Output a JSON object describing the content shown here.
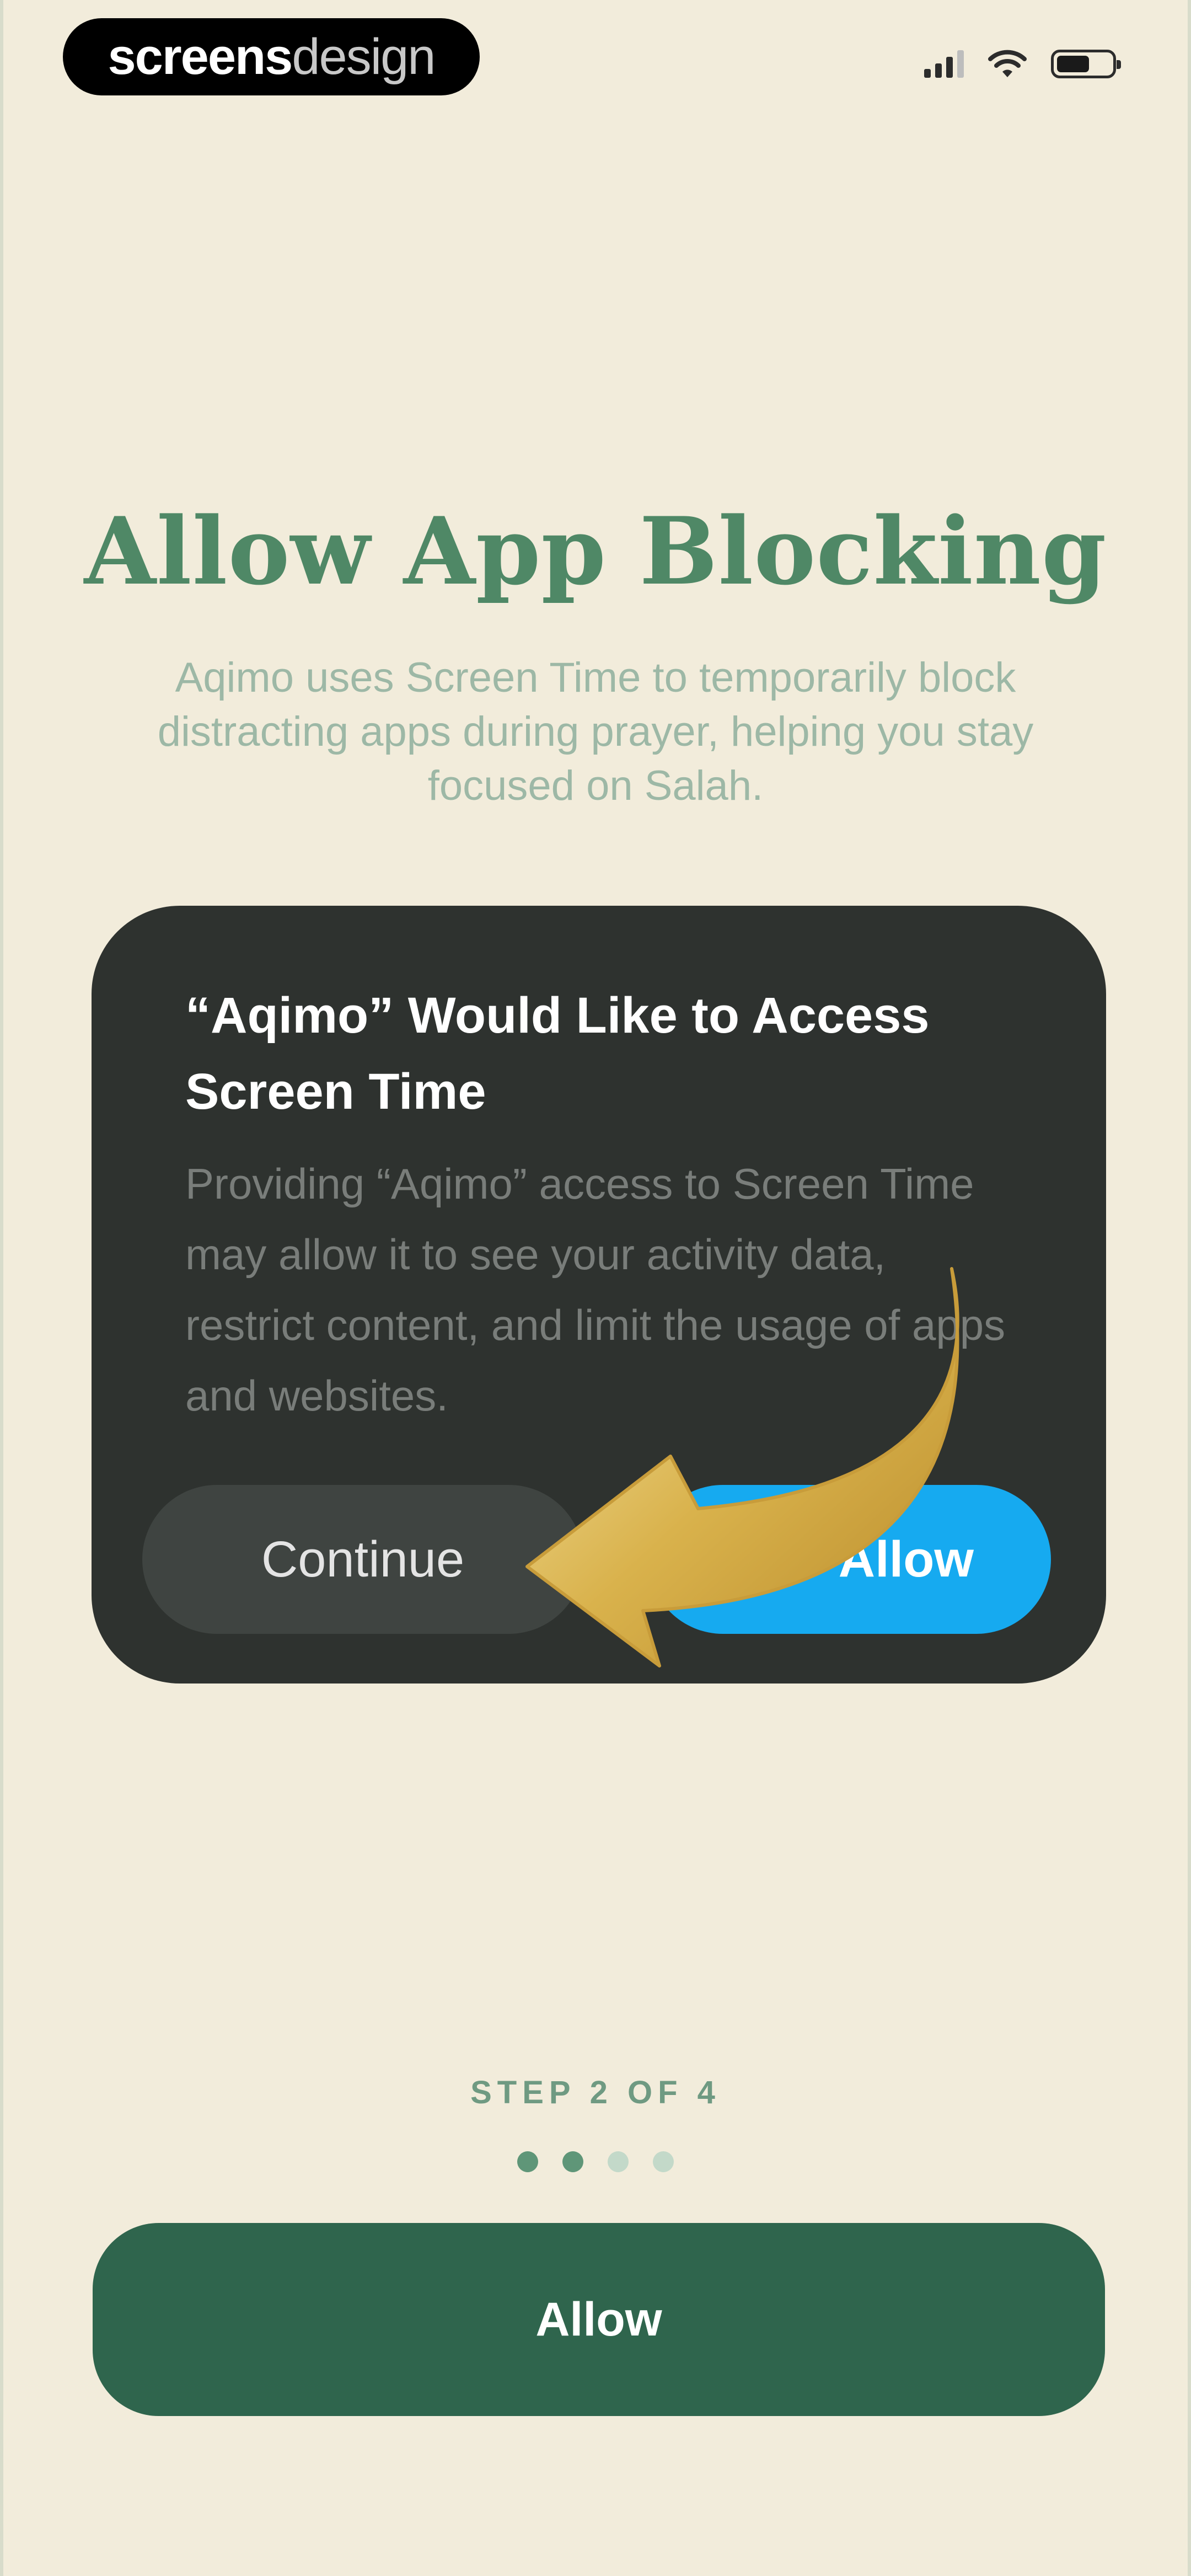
{
  "status_bar": {
    "watermark_bold": "screens",
    "watermark_light": "design",
    "icons": [
      "cellular-signal-icon",
      "wifi-icon",
      "battery-icon"
    ]
  },
  "onboarding": {
    "title": "Allow App Blocking",
    "subtitle": "Aqimo uses Screen Time to temporarily block distracting apps during prayer, helping you stay focused on Salah."
  },
  "dialog": {
    "title": "“Aqimo” Would Like to Access Screen Time",
    "message": "Providing “Aqimo” access to Screen Time may allow it to see your activity data, restrict content, and limit the usage of apps and websites.",
    "continue_label": "Continue",
    "allow_label": "Allow",
    "arrow_icon": "curved-arrow-pointer-icon"
  },
  "progress": {
    "step_label": "STEP 2 OF 4",
    "current_step": 2,
    "total_steps": 4
  },
  "primary_button": {
    "label": "Allow"
  },
  "colors": {
    "background": "#f2ecdb",
    "title": "#4f8866",
    "dialog_bg": "#2e322f",
    "dialog_allow": "#16aaf0",
    "primary_button": "#2f654d",
    "arrow_gold": "#d9b24c"
  }
}
